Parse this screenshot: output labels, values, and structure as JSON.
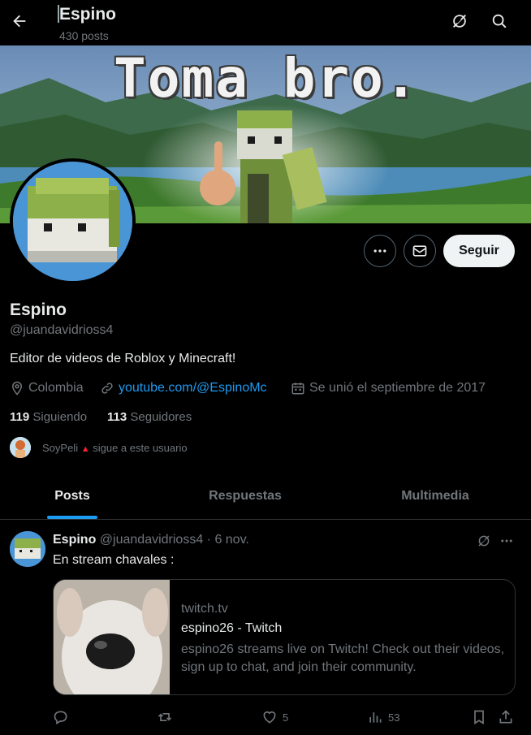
{
  "header": {
    "title": "Espino",
    "posts_count": "430 posts"
  },
  "banner": {
    "text": "Toma bro."
  },
  "actions": {
    "follow_label": "Seguir"
  },
  "profile": {
    "name": "Espino",
    "handle": "@juandavidrioss4",
    "bio": "Editor de videos de Roblox y Minecraft!",
    "location": "Colombia",
    "website": "youtube.com/@EspinoMc",
    "joined": "Se unió el septiembre de 2017",
    "following_count": "119",
    "following_label": "Siguiendo",
    "followers_count": "113",
    "followers_label": "Seguidores",
    "followed_by_name": "SoyPeli",
    "followed_by_text": "sigue a este usuario"
  },
  "tabs": [
    {
      "label": "Posts"
    },
    {
      "label": "Respuestas"
    },
    {
      "label": "Multimedia"
    }
  ],
  "post": {
    "name": "Espino",
    "meta": "@juandavidrioss4 · 6 nov.",
    "text": "En stream chavales :",
    "card": {
      "domain": "twitch.tv",
      "title": "espino26 - Twitch",
      "description": "espino26 streams live on Twitch! Check out their videos, sign up to chat, and join their community."
    },
    "likes": "5",
    "views": "53"
  },
  "colors": {
    "accent": "#1d9bf0",
    "background": "#000000",
    "text": "#e7e9ea",
    "muted": "#71767b",
    "border": "#2f3336"
  }
}
